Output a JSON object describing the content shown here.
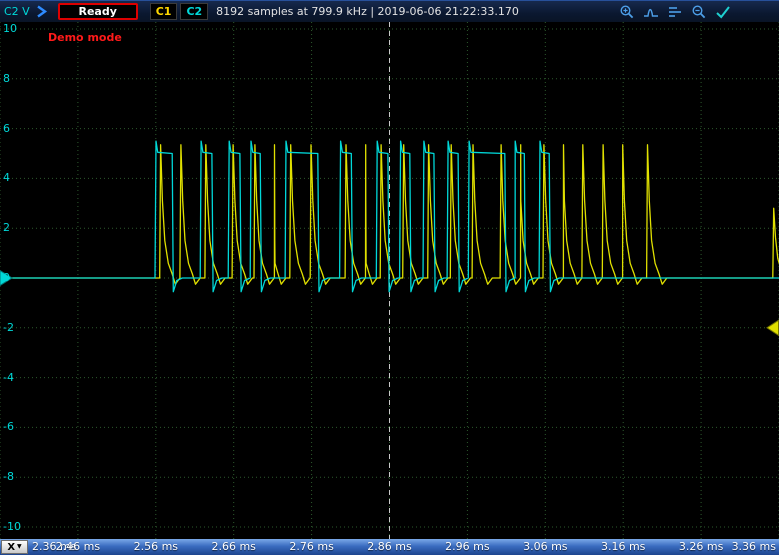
{
  "toolbar": {
    "status_label": "Ready",
    "ch1_label": "C1",
    "ch2_label": "C2",
    "info_text": "8192 samples at 799.9 kHz | 2019-06-06 21:22:33.170",
    "icons": [
      "zoom-in",
      "peak-trace",
      "levels",
      "zoom-out",
      "confirm-check"
    ]
  },
  "plot": {
    "y_axis_unit": "C2 V",
    "demo_label": "Demo mode",
    "y_ticks": [
      10,
      8,
      6,
      4,
      2,
      0,
      -2,
      -4,
      -6,
      -8,
      -10
    ],
    "grid_color": "#2d5a2d",
    "cursor_color": "#c8c8c8",
    "background": "#000000",
    "time_cursor_ms": 2.86
  },
  "x_axis": {
    "selector_label": "X",
    "ticks": [
      "2.36 ms",
      "2.46 ms",
      "2.56 ms",
      "2.66 ms",
      "2.76 ms",
      "2.86 ms",
      "2.96 ms",
      "3.06 ms",
      "3.16 ms",
      "3.26 ms",
      "3.36 ms"
    ]
  },
  "chart_data": {
    "type": "line",
    "x_unit": "ms",
    "y_unit": "V",
    "x_range": [
      2.36,
      3.36
    ],
    "y_range": [
      -10,
      10
    ],
    "x_tick_step": 0.1,
    "y_tick_step": 2,
    "grid": "dotted",
    "series": [
      {
        "name": "C1",
        "color": "#e0e000",
        "shape": "spike",
        "amplitude_v": 5.3,
        "marker_v": -2,
        "pulses": [
          {
            "t": 2.565
          },
          {
            "t": 2.591
          },
          {
            "t": 2.623
          },
          {
            "t": 2.658
          },
          {
            "t": 2.686
          },
          {
            "t": 2.701
          },
          {
            "t": 2.732
          },
          {
            "t": 2.758
          },
          {
            "t": 2.803
          },
          {
            "t": 2.818
          },
          {
            "t": 2.848
          },
          {
            "t": 2.877
          },
          {
            "t": 2.909
          },
          {
            "t": 2.938
          },
          {
            "t": 2.966
          },
          {
            "t": 3.002
          },
          {
            "t": 3.025
          },
          {
            "t": 3.057
          },
          {
            "t": 3.081
          },
          {
            "t": 3.107
          },
          {
            "t": 3.133
          },
          {
            "t": 3.158
          },
          {
            "t": 3.19
          },
          {
            "t": 3.352,
            "a": 2.8
          }
        ]
      },
      {
        "name": "C2",
        "color": "#00d8d8",
        "shape": "flat",
        "amplitude_v": 5.0,
        "marker_v": 0,
        "pulses": [
          {
            "t": 2.559,
            "w": 0.022
          },
          {
            "t": 2.617,
            "w": 0.015
          },
          {
            "t": 2.653,
            "w": 0.015
          },
          {
            "t": 2.681,
            "w": 0.013
          },
          {
            "t": 2.726,
            "w": 0.042
          },
          {
            "t": 2.796,
            "w": 0.015
          },
          {
            "t": 2.843,
            "w": 0.015
          },
          {
            "t": 2.873,
            "w": 0.013
          },
          {
            "t": 2.903,
            "w": 0.014
          },
          {
            "t": 2.934,
            "w": 0.014
          },
          {
            "t": 2.961,
            "w": 0.047
          },
          {
            "t": 3.02,
            "w": 0.013
          },
          {
            "t": 3.052,
            "w": 0.013
          }
        ]
      }
    ]
  }
}
